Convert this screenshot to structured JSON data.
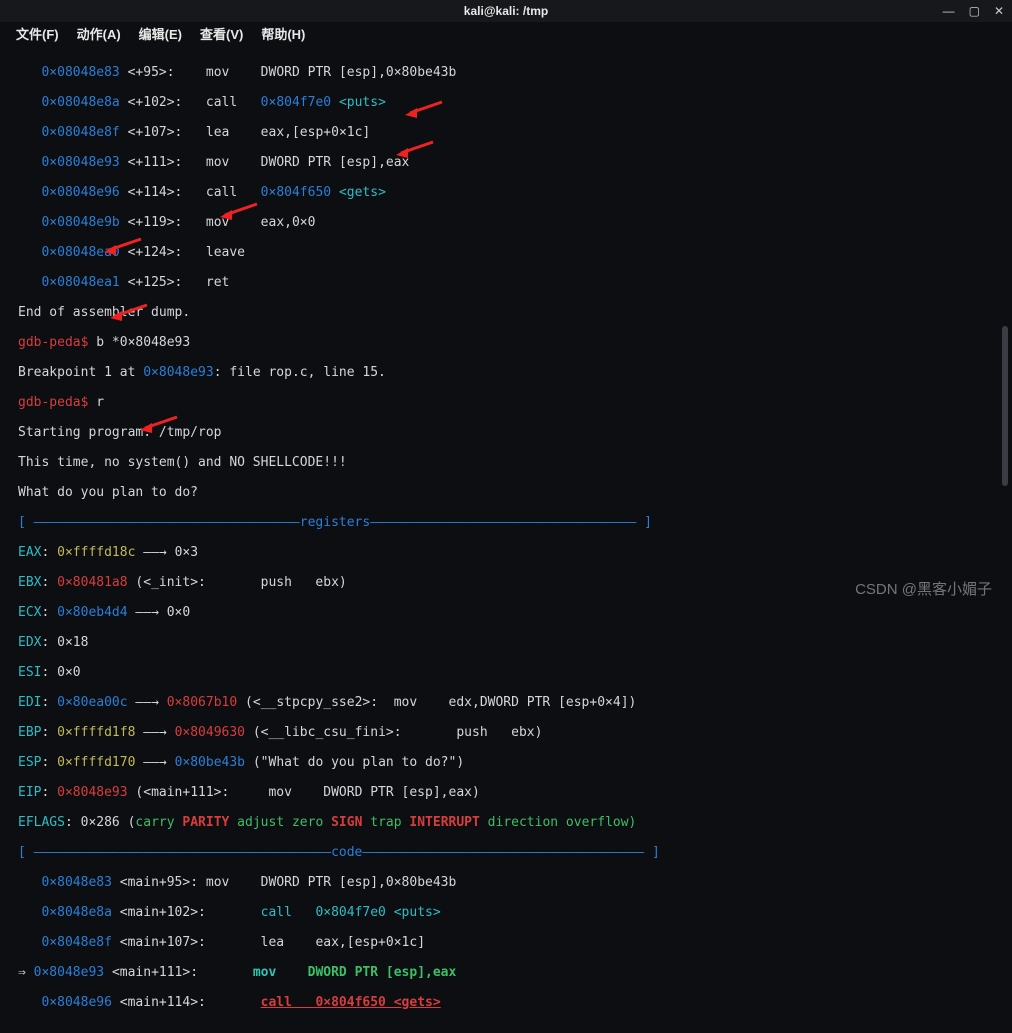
{
  "window": {
    "title": "kali@kali: /tmp"
  },
  "menubar": {
    "file": "文件(F)",
    "actions": "动作(A)",
    "edit": "编辑(E)",
    "view": "查看(V)",
    "help": "帮助(H)"
  },
  "winctrls": {
    "min": "—",
    "max": "▢",
    "close": "✕"
  },
  "disasm": [
    {
      "addr": "0×08048e83",
      "off": "<+95>:",
      "op": "mov",
      "args": "DWORD PTR [esp],0×80be43b"
    },
    {
      "addr": "0×08048e8a",
      "off": "<+102>:",
      "op": "call",
      "args_addr": "0×804f7e0",
      "args_sym": "<puts>"
    },
    {
      "addr": "0×08048e8f",
      "off": "<+107>:",
      "op": "lea",
      "args": "eax,[esp+0×1c]"
    },
    {
      "addr": "0×08048e93",
      "off": "<+111>:",
      "op": "mov",
      "args": "DWORD PTR [esp],eax"
    },
    {
      "addr": "0×08048e96",
      "off": "<+114>:",
      "op": "call",
      "args_addr": "0×804f650",
      "args_sym": "<gets>"
    },
    {
      "addr": "0×08048e9b",
      "off": "<+119>:",
      "op": "mov",
      "args": "eax,0×0"
    },
    {
      "addr": "0×08048ea0",
      "off": "<+124>:",
      "op": "leave",
      "args": ""
    },
    {
      "addr": "0×08048ea1",
      "off": "<+125>:",
      "op": "ret",
      "args": ""
    }
  ],
  "end_dump": "End of assembler dump.",
  "prompt": "gdb-peda$",
  "cmd_break": "b *0×8048e93",
  "bp_line_pre": "Breakpoint 1 at ",
  "bp_addr": "0×8048e93",
  "bp_line_post": ": file rop.c, line 15.",
  "cmd_run": "r",
  "starting": "Starting program: /tmp/rop",
  "banner1": "This time, no system() and NO SHELLCODE!!!",
  "banner2": "What do you plan to do?",
  "sep_regs": {
    "open": "[ ",
    "dash1": "——————————————————————————————————",
    "label": "registers",
    "dash2": "—————————————————————————————————— ]"
  },
  "regs": {
    "eax": {
      "name": "EAX",
      "val": "0×ffffd18c",
      "arrow": " ——→ ",
      "tgt": "0×3"
    },
    "ebx": {
      "name": "EBX",
      "val": "0×80481a8",
      "paren": " (<_init>:       push   ebx)"
    },
    "ecx": {
      "name": "ECX",
      "val": "0×80eb4d4",
      "arrow": " ——→ ",
      "tgt": "0×0"
    },
    "edx": {
      "name": "EDX",
      "val": "0×18"
    },
    "esi": {
      "name": "ESI",
      "val": "0×0"
    },
    "edi": {
      "name": "EDI",
      "val": "0×80ea00c",
      "arrow": " ——→ ",
      "mid": "0×8067b10",
      "paren": " (<__stpcpy_sse2>:  mov    edx,DWORD PTR [esp+0×4])"
    },
    "ebp": {
      "name": "EBP",
      "val": "0×ffffd1f8",
      "arrow": " ——→ ",
      "mid": "0×8049630",
      "paren": " (<__libc_csu_fini>:       push   ebx)"
    },
    "esp": {
      "name": "ESP",
      "val": "0×ffffd170",
      "arrow": " ——→ ",
      "mid": "0×80be43b",
      "paren": " (\"What do you plan to do?\")"
    },
    "eip": {
      "name": "EIP",
      "val": "0×8048e93",
      "paren": " (<main+111>:     mov    DWORD PTR [esp],eax)"
    },
    "eflags_name": "EFLAGS",
    "eflags_val": "0×286",
    "eflags_flags": {
      "pre": " (",
      "carry": "carry",
      "parity": "PARITY",
      "adjust": " adjust zero",
      "sign": "SIGN",
      "trap": " trap ",
      "interrupt": "INTERRUPT",
      "post": " direction overflow)"
    }
  },
  "sep_code": {
    "open": "[ ",
    "dash1": "——————————————————————————————————————",
    "label": "code",
    "dash2": "———————————————————————————————————— ]"
  },
  "code": [
    {
      "pre": "   ",
      "addr": "0×8048e83",
      "sym": "<main+95>:",
      "ins": "mov    DWORD PTR [esp],0×80be43b"
    },
    {
      "pre": "   ",
      "addr": "0×8048e8a",
      "sym": "<main+102>:",
      "ins_pre": "",
      "call": "call   0×804f7e0 <puts>"
    },
    {
      "pre": "   ",
      "addr": "0×8048e8f",
      "sym": "<main+107>:",
      "ins": "lea    eax,[esp+0×1c]"
    },
    {
      "pre": "⇒ ",
      "addr": "0×8048e93",
      "sym": "<main+111>:",
      "mov": "mov    ",
      "arg": "DWORD PTR [esp],eax"
    },
    {
      "pre": "   ",
      "addr": "0×8048e96",
      "sym": "<main+114>:",
      "call2": "call   0×804f650 <gets>"
    }
  ],
  "watermark": "CSDN @黑客小媚子"
}
